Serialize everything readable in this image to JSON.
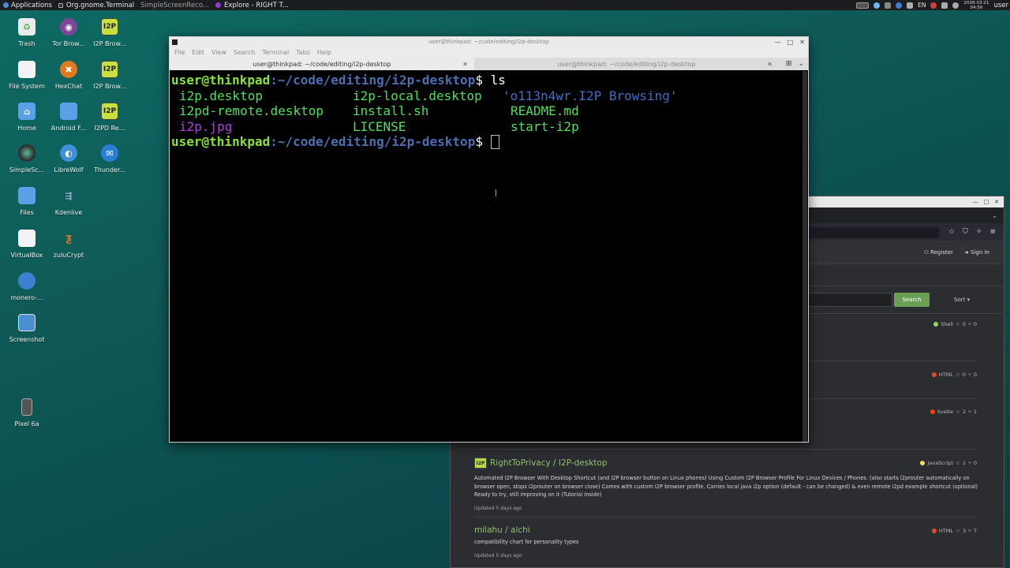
{
  "panel": {
    "applications": "Applications",
    "tasks": [
      "Org.gnome.Terminal",
      "SimpleScreenReco...",
      "Explore - RIGHT T..."
    ],
    "lang": "EN",
    "date": "2026-03-21",
    "time": "04:56",
    "user": "user"
  },
  "desktop": {
    "icons": [
      {
        "label": "Trash"
      },
      {
        "label": "Tor Brow..."
      },
      {
        "label": "I2P Brow..."
      },
      {
        "label": "File System"
      },
      {
        "label": "HexChat"
      },
      {
        "label": "I2P Brow..."
      },
      {
        "label": "Home"
      },
      {
        "label": "Android F..."
      },
      {
        "label": "I2PD Re..."
      },
      {
        "label": "SimpleSc..."
      },
      {
        "label": "LibreWolf"
      },
      {
        "label": "Thunder..."
      },
      {
        "label": "Files"
      },
      {
        "label": "Kdenlive"
      },
      {
        "label": "VirtualBox"
      },
      {
        "label": "zuluCrypt"
      },
      {
        "label": "monero-..."
      },
      {
        "label": "Screenshot"
      },
      {
        "label": "Pixel 6a"
      }
    ],
    "i2p_glyph": "I2P"
  },
  "terminal": {
    "title": "user@thinkpad: ~/code/editing/i2p-desktop",
    "menu": [
      "File",
      "Edit",
      "View",
      "Search",
      "Terminal",
      "Tabs",
      "Help"
    ],
    "tabs": [
      "user@thinkpad: ~/code/editing/i2p-desktop",
      "user@thinkpad: ~/code/editing/i2p-desktop"
    ],
    "prompt_user": "user@thinkpad",
    "prompt_path": ":~/code/editing/i2p-desktop",
    "prompt_sign": "$ ",
    "command": "ls",
    "ls": [
      [
        "i2p.desktop",
        "i2p-local.desktop",
        "'o113n4wr.I2P Browsing'"
      ],
      [
        "i2pd-remote.desktop",
        "install.sh",
        "README.md"
      ],
      [
        "i2p.jpg",
        "LICENSE",
        "start-i2p"
      ]
    ]
  },
  "browser": {
    "register": "Register",
    "sign_in": "Sign In",
    "search_button": "Search",
    "sort": "Sort",
    "partial_repos": [
      {
        "lang": "Shell",
        "lang_color": "#89e051",
        "stars": "0",
        "forks": "0"
      },
      {
        "lang": "HTML",
        "lang_color": "#e34c26",
        "stars": "0",
        "forks": "0"
      },
      {
        "lang": "Svelte",
        "lang_color": "#ff3e00",
        "stars": "2",
        "forks": "1"
      }
    ],
    "repos": [
      {
        "title": "RightToPrivacy / I2P-desktop",
        "desc": "Automated I2P Browser With Desktop Shortcut (and I2P browser button on Linux phones) Using Custom I2P Browser Profile For Linux Devices / Phones. (also starts i2prouter automatically on browser open, stops i2prouter on browser close) Comes with custom I2P browser profile. Carries local java i2p option (default - can be changed) & even remote i2pd example shortcut (optional) Ready to try, still improving on it (Tutorial Inside)",
        "updated": "Updated 5 days ago",
        "lang": "JavaScript",
        "lang_color": "#f1e05a",
        "stars": "1",
        "forks": "0"
      },
      {
        "title": "milahu / alchi",
        "desc": "compatibility chart for personality types",
        "updated": "Updated 5 days ago",
        "lang": "HTML",
        "lang_color": "#e34c26",
        "stars": "3",
        "forks": "7"
      }
    ]
  }
}
